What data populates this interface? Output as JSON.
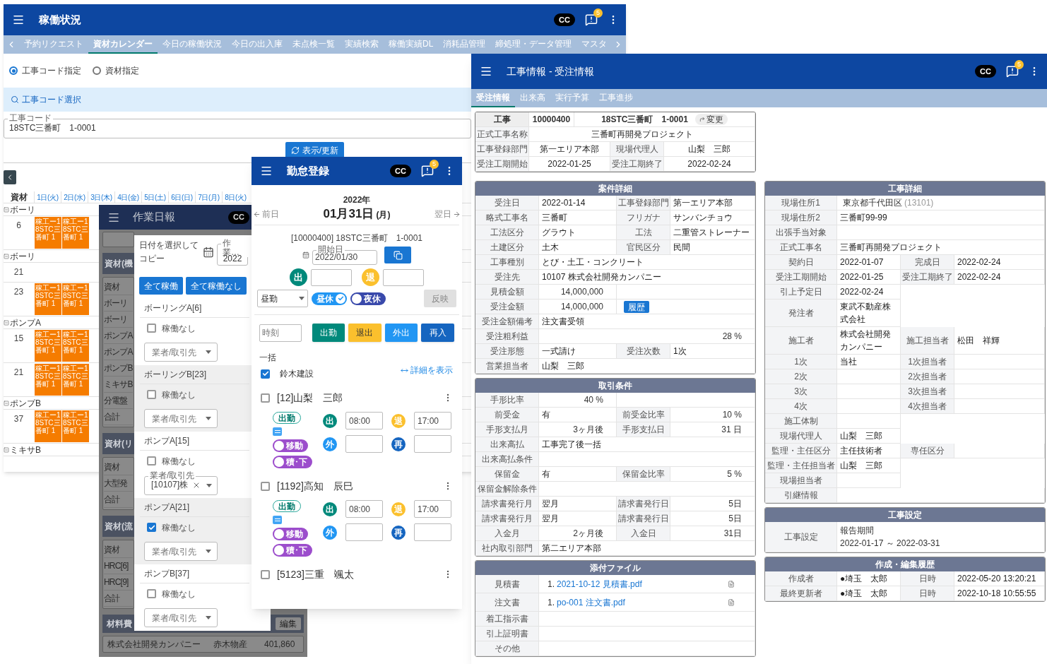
{
  "status_window": {
    "title": "稼働状況",
    "badge": "CC",
    "notification_count": "5",
    "tabs": [
      {
        "label": "予約リクエスト",
        "selected": false
      },
      {
        "label": "資材カレンダー",
        "selected": true
      },
      {
        "label": "今日の稼働状況",
        "selected": false
      },
      {
        "label": "今日の出入庫",
        "selected": false
      },
      {
        "label": "未点検一覧",
        "selected": false
      },
      {
        "label": "実績検索",
        "selected": false
      },
      {
        "label": "稼働実績DL",
        "selected": false
      },
      {
        "label": "消耗品管理",
        "selected": false
      },
      {
        "label": "締処理・データ管理",
        "selected": false
      },
      {
        "label": "マスタ",
        "selected": false
      }
    ],
    "radios": [
      {
        "label": "工事コード指定",
        "selected": true
      },
      {
        "label": "資材指定",
        "selected": false
      }
    ],
    "search_label": "工事コード選択",
    "code_field": {
      "label": "工事コード",
      "value": "18STC三番町　1-0001"
    },
    "refresh_button": "表示/更新",
    "calendar": {
      "corner": "資材",
      "days": [
        "1日(火)",
        "2日(水)",
        "3日(木)",
        "4日(金)",
        "5日(土)",
        "6日(日)",
        "7日(月)",
        "8日(火)"
      ],
      "groups": [
        {
          "name": "ボーリ",
          "rows": [
            {
              "number": "6",
              "bookings": [
                "稼工ー18STC三番町 1",
                "稼工ー18STC三番町 1"
              ]
            }
          ]
        },
        {
          "name": "ボーリ",
          "rows": [
            {
              "number": "21",
              "bookings": []
            },
            {
              "number": "23",
              "bookings": [
                "稼工ー18STC三番町 1",
                "稼工ー18STC三番町 1"
              ]
            }
          ]
        },
        {
          "name": "ポンプA",
          "rows": [
            {
              "number": "15",
              "bookings": [
                "稼工ー18STC三番町 1",
                "稼工ー18STC三番町 1"
              ]
            },
            {
              "number": "21",
              "bookings": [
                "稼工ー18STC三番町 1",
                "稼工ー18STC三番町 1"
              ]
            }
          ]
        },
        {
          "name": "ポンプB",
          "rows": [
            {
              "number": "37",
              "bookings": [
                "稼工ー18STC三番町 1",
                "稼工ー18STC三番町 1"
              ]
            }
          ]
        },
        {
          "name": "ミキサB"
        }
      ]
    }
  },
  "daily_report_window": {
    "title": "作業日報",
    "badge": "CC",
    "background": {
      "sections": [
        {
          "title": "資材(機",
          "rows": [
            "資材",
            "ボーリ",
            "ボーリ",
            "ポンプA",
            "ポンプA",
            "ポンプB",
            "ミキサB",
            "分電盤",
            "合計"
          ]
        },
        {
          "title": "資材(リ",
          "rows": [
            "資材",
            "大型発",
            "合計"
          ]
        },
        {
          "title": "資材(流",
          "rows": [
            "資材",
            "HRC[6]",
            "HRC[9]",
            "合計"
          ]
        }
      ],
      "cost_title": "材料費",
      "edit_button": "編集",
      "cost_row": [
        "株式会社開発カンパニー",
        "赤木物産",
        "401,860"
      ]
    },
    "dialog": {
      "copy_label": "日付を選択してコピー",
      "date_field": {
        "label": "作業…",
        "value": "2022"
      },
      "buttons": [
        "全て稼働",
        "全て稼働なし"
      ],
      "machines": [
        {
          "name": "ボーリングA[6]",
          "checkbox_label": "稼働なし",
          "checked": false,
          "vendor": {
            "placeholder": "業者/取引先"
          }
        },
        {
          "name": "ボーリングB[23]",
          "checkbox_label": "稼働なし",
          "checked": false,
          "vendor": {
            "placeholder": "業者/取引先"
          }
        },
        {
          "name": "ポンプA[15]",
          "checkbox_label": "稼働なし",
          "checked": false,
          "vendor": {
            "label": "業者/取引先",
            "value": "[10107]株"
          }
        },
        {
          "name": "ポンプA[21]",
          "checkbox_label": "稼働なし",
          "checked": true,
          "vendor": {
            "placeholder": "業者/取引先"
          }
        },
        {
          "name": "ポンプB[37]",
          "checkbox_label": "稼働なし",
          "checked": false,
          "vendor": {
            "placeholder": "業者/取引先"
          }
        }
      ]
    }
  },
  "attendance_window": {
    "title": "勤怠登録",
    "badge": "CC",
    "notification_count": "5",
    "year": "2022年",
    "date": "01月31日",
    "weekday": "(月)",
    "prev": "前日",
    "next": "翌日",
    "project": "[10000400] 18STC三番町　1-0001",
    "start_field": {
      "label": "開始日",
      "value": "2022/01/30"
    },
    "clock": [
      {
        "label": "出",
        "color": "#00897b"
      },
      {
        "label": "退",
        "color": "#fbc02d"
      }
    ],
    "shift_select": "昼勤",
    "breaks": [
      {
        "label": "昼休",
        "on": true,
        "color": "#2196f3"
      },
      {
        "label": "夜休",
        "on": false,
        "color": "#3949ab"
      }
    ],
    "apply_button": {
      "label": "反映",
      "disabled": true
    },
    "time_field": {
      "placeholder": "時刻"
    },
    "punch_buttons": [
      {
        "label": "出勤",
        "color": "#00897b"
      },
      {
        "label": "退出",
        "color": "#fbc02d"
      },
      {
        "label": "外出",
        "color": "#2196f3"
      },
      {
        "label": "再入",
        "color": "#1565c0"
      }
    ],
    "bulk_label": "一括",
    "company": {
      "label": "鈴木建設",
      "checked": true
    },
    "detail_link": "詳細を表示",
    "workers": [
      {
        "name": "[12]山梨　三郎",
        "checked": false,
        "status": "出勤",
        "toggles": [
          {
            "label": "移動",
            "on": false,
            "color": "#9c4dcc"
          },
          {
            "label": "積･下",
            "on": false,
            "color": "#9c4dcc"
          }
        ],
        "times": [
          {
            "label": "出",
            "value": "08:00",
            "color": "#00897b"
          },
          {
            "label": "退",
            "value": "17:00",
            "color": "#fbc02d"
          },
          {
            "label": "外",
            "color": "#2196f3"
          },
          {
            "label": "再",
            "color": "#1565c0"
          }
        ]
      },
      {
        "name": "[1192]高知　辰巳",
        "checked": false,
        "status": "出勤",
        "toggles": [
          {
            "label": "移動",
            "on": false,
            "color": "#9c4dcc"
          },
          {
            "label": "積･下",
            "on": false,
            "color": "#9c4dcc"
          }
        ],
        "times": [
          {
            "label": "出",
            "value": "08:00",
            "color": "#00897b"
          },
          {
            "label": "退",
            "value": "17:00",
            "color": "#fbc02d"
          },
          {
            "label": "外",
            "color": "#2196f3"
          },
          {
            "label": "再",
            "color": "#1565c0"
          }
        ]
      },
      {
        "name": "[5123]三重　颯太",
        "checked": false
      }
    ]
  },
  "project_window": {
    "title": "工事情報 - 受注情報",
    "badge": "CC",
    "notification_count": "5",
    "tabs": [
      {
        "label": "受注情報",
        "selected": true
      },
      {
        "label": "出来高",
        "selected": false
      },
      {
        "label": "実行予算",
        "selected": false
      },
      {
        "label": "工事進捗",
        "selected": false
      }
    ],
    "summary": {
      "project": {
        "label": "工事",
        "code": "10000400",
        "name": "18STC三番町　1-0001",
        "change_button": "変更"
      },
      "rows": [
        [
          {
            "text": "正式工事名称",
            "kind": "label"
          },
          {
            "text": "三番町再開発プロジェクト",
            "kind": "value"
          }
        ],
        [
          {
            "text": "工事登録部門",
            "kind": "label"
          },
          {
            "text": "第一エリア本部",
            "kind": "value"
          },
          {
            "text": "現場代理人",
            "kind": "label"
          },
          {
            "text": "山梨　三郎",
            "kind": "value"
          }
        ],
        [
          {
            "text": "受注工期開始",
            "kind": "label"
          },
          {
            "text": "2022-01-25",
            "kind": "value"
          },
          {
            "text": "受注工期終了",
            "kind": "label"
          },
          {
            "text": "2022-02-24",
            "kind": "value"
          }
        ]
      ]
    },
    "left_cards": [
      {
        "title": "案件詳細",
        "rows": [
          [
            {
              "text": "受注日",
              "kind": "label"
            },
            {
              "text": "2022-01-14",
              "kind": "value"
            },
            {
              "text": "工事登録部門",
              "kind": "label"
            },
            {
              "text": "第一エリア本部",
              "kind": "value"
            }
          ],
          [
            {
              "text": "略式工事名",
              "kind": "label"
            },
            {
              "text": "三番町",
              "kind": "value"
            },
            {
              "text": "フリガナ",
              "kind": "label"
            },
            {
              "text": "サンバンチョウ",
              "kind": "value"
            }
          ],
          [
            {
              "text": "工法区分",
              "kind": "label"
            },
            {
              "text": "グラウト",
              "kind": "value"
            },
            {
              "text": "工法",
              "kind": "label"
            },
            {
              "text": "二重管ストレーナー",
              "kind": "value"
            }
          ],
          [
            {
              "text": "土建区分",
              "kind": "label"
            },
            {
              "text": "土木",
              "kind": "value"
            },
            {
              "text": "官民区分",
              "kind": "label"
            },
            {
              "text": "民間",
              "kind": "value"
            }
          ],
          [
            {
              "text": "工事種別",
              "kind": "label"
            },
            {
              "text": "とび・土工・コンクリート",
              "kind": "value"
            }
          ],
          [
            {
              "text": "受注先",
              "kind": "label"
            },
            {
              "text": "10107 株式会社開発カンパニー",
              "kind": "value"
            }
          ],
          [
            {
              "text": "見積金額",
              "kind": "label"
            },
            {
              "text": "14,000,000",
              "kind": "number"
            },
            {
              "kind": "value"
            }
          ],
          [
            {
              "text": "受注金額",
              "kind": "label"
            },
            {
              "text": "14,000,000",
              "kind": "number"
            },
            {
              "text": "履歴",
              "kind": "button"
            }
          ],
          [
            {
              "text": "受注金額備考",
              "kind": "label"
            },
            {
              "text": "注文書受領",
              "kind": "value"
            }
          ],
          [
            {
              "text": "受注粗利益",
              "kind": "label"
            },
            {
              "kind": "fill"
            },
            {
              "kind": "fill"
            },
            {
              "text": "28 %",
              "kind": "number"
            }
          ],
          [
            {
              "text": "受注形態",
              "kind": "label"
            },
            {
              "text": "一式請け",
              "kind": "value"
            },
            {
              "text": "受注次数",
              "kind": "label"
            },
            {
              "text": "1次",
              "kind": "value"
            }
          ],
          [
            {
              "text": "営業担当者",
              "kind": "label"
            },
            {
              "text": "山梨　三郎",
              "kind": "value"
            }
          ]
        ]
      },
      {
        "title": "取引条件",
        "rows": [
          [
            {
              "text": "手形比率",
              "kind": "label"
            },
            {
              "text": "40 %",
              "kind": "number"
            },
            {
              "kind": "value"
            }
          ],
          [
            {
              "text": "前受金",
              "kind": "label"
            },
            {
              "text": "有",
              "kind": "value"
            },
            {
              "text": "前受金比率",
              "kind": "label"
            },
            {
              "text": "10 %",
              "kind": "number"
            }
          ],
          [
            {
              "text": "手形支払月",
              "kind": "label"
            },
            {
              "text": "3ヶ月後",
              "kind": "number"
            },
            {
              "text": "手形支払日",
              "kind": "label"
            },
            {
              "text": "31 日",
              "kind": "number"
            }
          ],
          [
            {
              "text": "出来高払",
              "kind": "label"
            },
            {
              "text": "工事完了後一括",
              "kind": "value"
            }
          ],
          [
            {
              "text": "出来高払条件",
              "kind": "label"
            },
            {
              "kind": "value"
            }
          ],
          [
            {
              "text": "保留金",
              "kind": "label"
            },
            {
              "text": "有",
              "kind": "value"
            },
            {
              "text": "保留金比率",
              "kind": "label"
            },
            {
              "text": "5 %",
              "kind": "number"
            }
          ],
          [
            {
              "text": "保留金解除条件",
              "kind": "label"
            },
            {
              "kind": "value"
            }
          ],
          [
            {
              "text": "請求書発行月",
              "kind": "label"
            },
            {
              "text": "翌月",
              "kind": "value"
            },
            {
              "text": "請求書発行日",
              "kind": "label"
            },
            {
              "text": "5日",
              "kind": "number"
            }
          ],
          [
            {
              "text": "請求書発行月",
              "kind": "label"
            },
            {
              "text": "翌月",
              "kind": "value"
            },
            {
              "text": "請求書発行日",
              "kind": "label"
            },
            {
              "text": "5日",
              "kind": "number"
            }
          ],
          [
            {
              "text": "入金月",
              "kind": "label"
            },
            {
              "text": "2ヶ月後",
              "kind": "number"
            },
            {
              "text": "入金日",
              "kind": "label"
            },
            {
              "text": "31日",
              "kind": "number"
            }
          ],
          [
            {
              "text": "社内取引部門",
              "kind": "label"
            },
            {
              "text": "第二エリア本部",
              "kind": "value"
            }
          ]
        ]
      },
      {
        "title": "添付ファイル",
        "rows": [
          [
            {
              "text": "見積書",
              "kind": "label"
            },
            {
              "kind": "file",
              "no": "1.",
              "text": "2021-10-12 見積書.pdf"
            }
          ],
          [
            {
              "text": "注文書",
              "kind": "label"
            },
            {
              "kind": "file",
              "no": "1.",
              "text": "po-001 注文書.pdf"
            }
          ],
          [
            {
              "text": "着工指示書",
              "kind": "label"
            },
            {
              "kind": "value"
            }
          ],
          [
            {
              "text": "引上証明書",
              "kind": "label"
            },
            {
              "kind": "value"
            }
          ],
          [
            {
              "text": "その他",
              "kind": "label"
            },
            {
              "kind": "value"
            }
          ]
        ]
      }
    ],
    "right_cards": [
      {
        "title": "工事詳細",
        "rows": [
          [
            {
              "text": "現場住所1",
              "kind": "label"
            },
            {
              "text": "東京都千代田区",
              "note": "(13101)",
              "kind": "value"
            }
          ],
          [
            {
              "text": "現場住所2",
              "kind": "label"
            },
            {
              "text": "三番町99-99",
              "kind": "value"
            }
          ],
          [
            {
              "text": "出張手当対象",
              "kind": "label"
            },
            {
              "kind": "value"
            }
          ],
          [
            {
              "text": "正式工事名",
              "kind": "label"
            },
            {
              "text": "三番町再開発プロジェクト",
              "kind": "value"
            }
          ],
          [
            {
              "text": "契約日",
              "kind": "label"
            },
            {
              "text": "2022-01-07",
              "kind": "value"
            },
            {
              "text": "完成日",
              "kind": "label"
            },
            {
              "text": "2022-02-24",
              "kind": "value"
            }
          ],
          [
            {
              "text": "受注工期開始",
              "kind": "label"
            },
            {
              "text": "2022-01-25",
              "kind": "value"
            },
            {
              "text": "受注工期終了",
              "kind": "label"
            },
            {
              "text": "2022-02-24",
              "kind": "value"
            }
          ],
          [
            {
              "text": "引上予定日",
              "kind": "label"
            },
            {
              "text": "2022-02-24",
              "kind": "value"
            },
            {
              "kind": "blank"
            }
          ],
          [
            {
              "text": "発注者",
              "kind": "label"
            },
            {
              "text": "東武不動産株式会社",
              "kind": "value"
            },
            {
              "kind": "blank"
            }
          ],
          [
            {
              "text": "施工者",
              "kind": "label"
            },
            {
              "text": "株式会社開発カンパニー",
              "kind": "value"
            },
            {
              "text": "施工担当者",
              "kind": "label"
            },
            {
              "text": "松田　祥輝",
              "kind": "value"
            }
          ],
          [
            {
              "text": "1次",
              "kind": "label"
            },
            {
              "text": "当社",
              "kind": "value"
            },
            {
              "text": "1次担当者",
              "kind": "label"
            },
            {
              "kind": "value"
            }
          ],
          [
            {
              "text": "2次",
              "kind": "label"
            },
            {
              "kind": "value"
            },
            {
              "text": "2次担当者",
              "kind": "label"
            },
            {
              "kind": "value"
            }
          ],
          [
            {
              "text": "3次",
              "kind": "label"
            },
            {
              "kind": "value"
            },
            {
              "text": "3次担当者",
              "kind": "label"
            },
            {
              "kind": "value"
            }
          ],
          [
            {
              "text": "4次",
              "kind": "label"
            },
            {
              "kind": "value"
            },
            {
              "text": "4次担当者",
              "kind": "label"
            },
            {
              "kind": "value"
            }
          ],
          [
            {
              "text": "施工体制",
              "kind": "label"
            },
            {
              "kind": "value"
            },
            {
              "kind": "blank"
            }
          ],
          [
            {
              "text": "現場代理人",
              "kind": "label"
            },
            {
              "text": "山梨　三郎",
              "kind": "value"
            },
            {
              "kind": "blank"
            }
          ],
          [
            {
              "text": "監理・主任区分",
              "kind": "label"
            },
            {
              "text": "主任技術者",
              "kind": "value"
            },
            {
              "text": "専任区分",
              "kind": "label"
            },
            {
              "kind": "value"
            }
          ],
          [
            {
              "text": "監理・主任担当者",
              "kind": "label"
            },
            {
              "text": "山梨　三郎",
              "kind": "value"
            },
            {
              "kind": "blank"
            }
          ],
          [
            {
              "text": "現場担当者",
              "kind": "label"
            },
            {
              "kind": "value"
            },
            {
              "kind": "blank"
            }
          ],
          [
            {
              "text": "引継情報",
              "kind": "label"
            },
            {
              "kind": "value"
            }
          ]
        ]
      },
      {
        "title": "工事設定",
        "rows": [
          [
            {
              "text": "工事設定",
              "kind": "label"
            },
            {
              "kind": "lines",
              "lines": [
                "報告期間",
                "2022-01-17 ～ 2022-03-31"
              ]
            }
          ]
        ]
      },
      {
        "title": "作成・編集履歴",
        "rows": [
          [
            {
              "text": "作成者",
              "kind": "label"
            },
            {
              "text": "●埼玉　太郎",
              "kind": "value"
            },
            {
              "text": "日時",
              "kind": "label"
            },
            {
              "text": "2022-05-20 13:20:21",
              "kind": "value"
            }
          ],
          [
            {
              "text": "最終更新者",
              "kind": "label"
            },
            {
              "text": "●埼玉　太郎",
              "kind": "value"
            },
            {
              "text": "日時",
              "kind": "label"
            },
            {
              "text": "2022-10-18 10:55:55",
              "kind": "value"
            }
          ]
        ]
      }
    ]
  }
}
